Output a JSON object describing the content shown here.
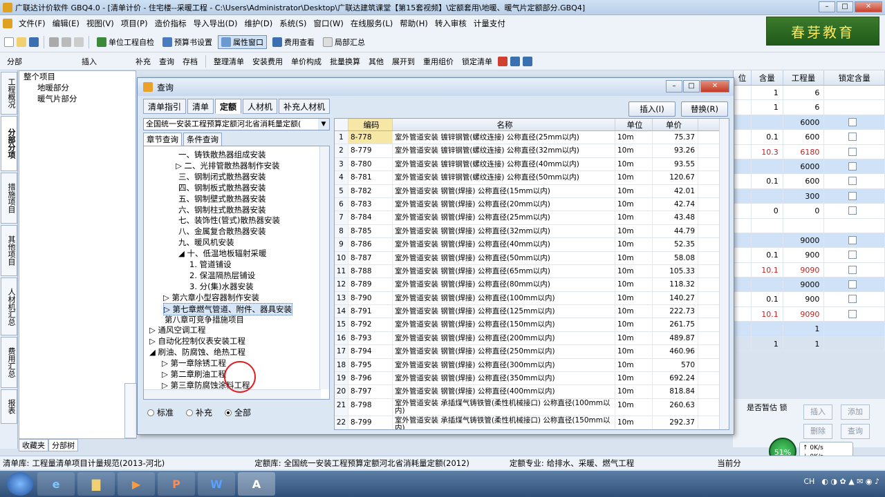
{
  "title": "广联达计价软件 GBQ4.0 - [清单计价 - 住宅楼--采暖工程 - C:\\Users\\Administrator\\Desktop\\广联达建筑课堂【第15套视频】\\定额套用\\地暖、暖气片定额部分.GBQ4]",
  "menu": [
    "文件(F)",
    "编辑(E)",
    "视图(V)",
    "项目(P)",
    "造价指标",
    "导入导出(D)",
    "维护(D)",
    "系统(S)",
    "窗口(W)",
    "在线服务(L)",
    "帮助(H)",
    "转入审核",
    "计量支付"
  ],
  "toolbar1": [
    "单位工程自检",
    "预算书设置",
    "属性窗口",
    "费用查看",
    "局部汇总"
  ],
  "toolbar2": [
    "分部",
    "插入",
    "补充",
    "查询",
    "存档",
    "整理清单",
    "安装费用",
    "单价构成",
    "批量换算",
    "其他",
    "展开到",
    "重用组价",
    "锁定清单"
  ],
  "logo": "春芽教育",
  "vtabs": [
    "工程概况",
    "分部分项",
    "措施项目",
    "其他项目",
    "人材机汇总",
    "费用汇总",
    "报表"
  ],
  "main_tree": [
    "整个项目",
    "地暖部分",
    "暖气片部分"
  ],
  "bottom_tabs": [
    "收藏夹",
    "分部树"
  ],
  "right_grid": {
    "headers": [
      "位",
      "含量",
      "工程量",
      "锁定含量"
    ],
    "rows": [
      {
        "hanliang": "1",
        "gcl": "6",
        "blue": false,
        "cb": false
      },
      {
        "hanliang": "1",
        "gcl": "6",
        "blue": false,
        "cb": false
      },
      {
        "hanliang": "",
        "gcl": "6000",
        "blue": true,
        "cb": true
      },
      {
        "hanliang": "0.1",
        "gcl": "600",
        "blue": false,
        "cb": true
      },
      {
        "hanliang": "10.3",
        "gcl": "6180",
        "blue": false,
        "cb": true,
        "red": true
      },
      {
        "hanliang": "",
        "gcl": "6000",
        "blue": true,
        "cb": true
      },
      {
        "hanliang": "0.1",
        "gcl": "600",
        "blue": false,
        "cb": true
      },
      {
        "hanliang": "",
        "gcl": "300",
        "blue": true,
        "cb": true
      },
      {
        "hanliang": "0",
        "gcl": "0",
        "blue": false,
        "cb": true
      },
      {
        "hanliang": "",
        "gcl": "",
        "blue": false,
        "cb": false
      },
      {
        "hanliang": "",
        "gcl": "9000",
        "blue": true,
        "cb": true
      },
      {
        "hanliang": "0.1",
        "gcl": "900",
        "blue": false,
        "cb": true
      },
      {
        "hanliang": "10.1",
        "gcl": "9090",
        "blue": false,
        "cb": true,
        "red": true
      },
      {
        "hanliang": "",
        "gcl": "9000",
        "blue": true,
        "cb": true
      },
      {
        "hanliang": "0.1",
        "gcl": "900",
        "blue": false,
        "cb": true
      },
      {
        "hanliang": "10.1",
        "gcl": "9090",
        "blue": false,
        "cb": true,
        "red": true
      },
      {
        "hanliang": "",
        "gcl": "1",
        "blue": true,
        "cb": false
      },
      {
        "hanliang": "1",
        "gcl": "1",
        "blue": false,
        "cb": false
      }
    ]
  },
  "right_lower": {
    "header": "是否暂估 锁",
    "buttons": [
      "插入",
      "添加",
      "删除",
      "查询"
    ]
  },
  "status": {
    "qdk_label": "清单库:",
    "qdk": "工程量清单项目计量规范(2013-河北)",
    "dek_label": "定额库:",
    "dek": "全国统一安装工程预算定额河北省消耗量定额(2012)",
    "dezy_label": "定额专业:",
    "dezy": "给排水、采暖、燃气工程",
    "tail": "当前分"
  },
  "cpu": "51%",
  "net": {
    "up": "0K/s",
    "down": "0K/s"
  },
  "taskbar_apps": [
    "e",
    "▶",
    "P",
    "W",
    "A"
  ],
  "tray": "CH",
  "dialog": {
    "title": "查询",
    "tabs": [
      "清单指引",
      "清单",
      "定额",
      "人材机",
      "补充人材机"
    ],
    "buttons": [
      "插入(I)",
      "替换(R)"
    ],
    "library": "全国统一安装工程预算定额河北省消耗量定额(",
    "subtabs": [
      "章节查询",
      "条件查询"
    ],
    "tree": [
      "一、铸铁散热器组成安装",
      "▷ 二、光排管散热器制作安装",
      "三、钢制闭式散热器安装",
      "四、钢制板式散热器安装",
      "五、钢制壁式散热器安装",
      "六、钢制柱式散热器安装",
      "七、装饰性(管式)散热器安装",
      "八、金属复合散热器安装",
      "九、暖风机安装",
      "◢ 十、低温地板辐射采暖",
      "1. 管道铺设",
      "2. 保温隔热层铺设",
      "3. 分(集)水器安装",
      "▷ 第六章小型容器制作安装",
      "▷ 第七章燃气管道、附件、器具安装",
      "第八章可竞争措施项目",
      "▷ 通风空调工程",
      "▷ 自动化控制仪表安装工程",
      "◢ 刷油、防腐蚀、绝热工程",
      "▷ 第一章除锈工程",
      "▷ 第二章刷油工程",
      "▷ 第三章防腐蚀涂料工程"
    ],
    "radios": [
      "标准",
      "补充",
      "全部"
    ],
    "grid_headers": [
      "编码",
      "名称",
      "单位",
      "单价"
    ],
    "rows": [
      {
        "n": "1",
        "code": "8-778",
        "name": "室外管道安装 镀锌钢管(螺纹连接) 公称直径(25mm以内)",
        "unit": "10m",
        "price": "75.37"
      },
      {
        "n": "2",
        "code": "8-779",
        "name": "室外管道安装 镀锌钢管(螺纹连接) 公称直径(32mm以内)",
        "unit": "10m",
        "price": "93.26"
      },
      {
        "n": "3",
        "code": "8-780",
        "name": "室外管道安装 镀锌钢管(螺纹连接) 公称直径(40mm以内)",
        "unit": "10m",
        "price": "93.55"
      },
      {
        "n": "4",
        "code": "8-781",
        "name": "室外管道安装 镀锌钢管(螺纹连接) 公称直径(50mm以内)",
        "unit": "10m",
        "price": "120.67"
      },
      {
        "n": "5",
        "code": "8-782",
        "name": "室外管道安装 钢管(焊接) 公称直径(15mm以内)",
        "unit": "10m",
        "price": "42.01"
      },
      {
        "n": "6",
        "code": "8-783",
        "name": "室外管道安装 钢管(焊接) 公称直径(20mm以内)",
        "unit": "10m",
        "price": "42.74"
      },
      {
        "n": "7",
        "code": "8-784",
        "name": "室外管道安装 钢管(焊接) 公称直径(25mm以内)",
        "unit": "10m",
        "price": "43.48"
      },
      {
        "n": "8",
        "code": "8-785",
        "name": "室外管道安装 钢管(焊接) 公称直径(32mm以内)",
        "unit": "10m",
        "price": "44.79"
      },
      {
        "n": "9",
        "code": "8-786",
        "name": "室外管道安装 钢管(焊接) 公称直径(40mm以内)",
        "unit": "10m",
        "price": "52.35"
      },
      {
        "n": "10",
        "code": "8-787",
        "name": "室外管道安装 钢管(焊接) 公称直径(50mm以内)",
        "unit": "10m",
        "price": "58.08"
      },
      {
        "n": "11",
        "code": "8-788",
        "name": "室外管道安装 钢管(焊接) 公称直径(65mm以内)",
        "unit": "10m",
        "price": "105.33"
      },
      {
        "n": "12",
        "code": "8-789",
        "name": "室外管道安装 钢管(焊接) 公称直径(80mm以内)",
        "unit": "10m",
        "price": "118.32"
      },
      {
        "n": "13",
        "code": "8-790",
        "name": "室外管道安装 钢管(焊接) 公称直径(100mm以内)",
        "unit": "10m",
        "price": "140.27"
      },
      {
        "n": "14",
        "code": "8-791",
        "name": "室外管道安装 钢管(焊接) 公称直径(125mm以内)",
        "unit": "10m",
        "price": "222.73"
      },
      {
        "n": "15",
        "code": "8-792",
        "name": "室外管道安装 钢管(焊接) 公称直径(150mm以内)",
        "unit": "10m",
        "price": "261.75"
      },
      {
        "n": "16",
        "code": "8-793",
        "name": "室外管道安装 钢管(焊接) 公称直径(200mm以内)",
        "unit": "10m",
        "price": "489.87"
      },
      {
        "n": "17",
        "code": "8-794",
        "name": "室外管道安装 钢管(焊接) 公称直径(250mm以内)",
        "unit": "10m",
        "price": "460.96"
      },
      {
        "n": "18",
        "code": "8-795",
        "name": "室外管道安装 钢管(焊接) 公称直径(300mm以内)",
        "unit": "10m",
        "price": "570"
      },
      {
        "n": "19",
        "code": "8-796",
        "name": "室外管道安装 钢管(焊接) 公称直径(350mm以内)",
        "unit": "10m",
        "price": "692.24"
      },
      {
        "n": "20",
        "code": "8-797",
        "name": "室外管道安装 钢管(焊接) 公称直径(400mm以内)",
        "unit": "10m",
        "price": "818.84"
      },
      {
        "n": "21",
        "code": "8-798",
        "name": "室外管道安装 承插煤气铸铁管(柔性机械接口) 公称直径(100mm以内)",
        "unit": "10m",
        "price": "260.63",
        "tall": true
      },
      {
        "n": "22",
        "code": "8-799",
        "name": "室外管道安装 承插煤气铸铁管(柔性机械接口) 公称直径(150mm以内)",
        "unit": "10m",
        "price": "292.37",
        "tall": true
      }
    ]
  }
}
